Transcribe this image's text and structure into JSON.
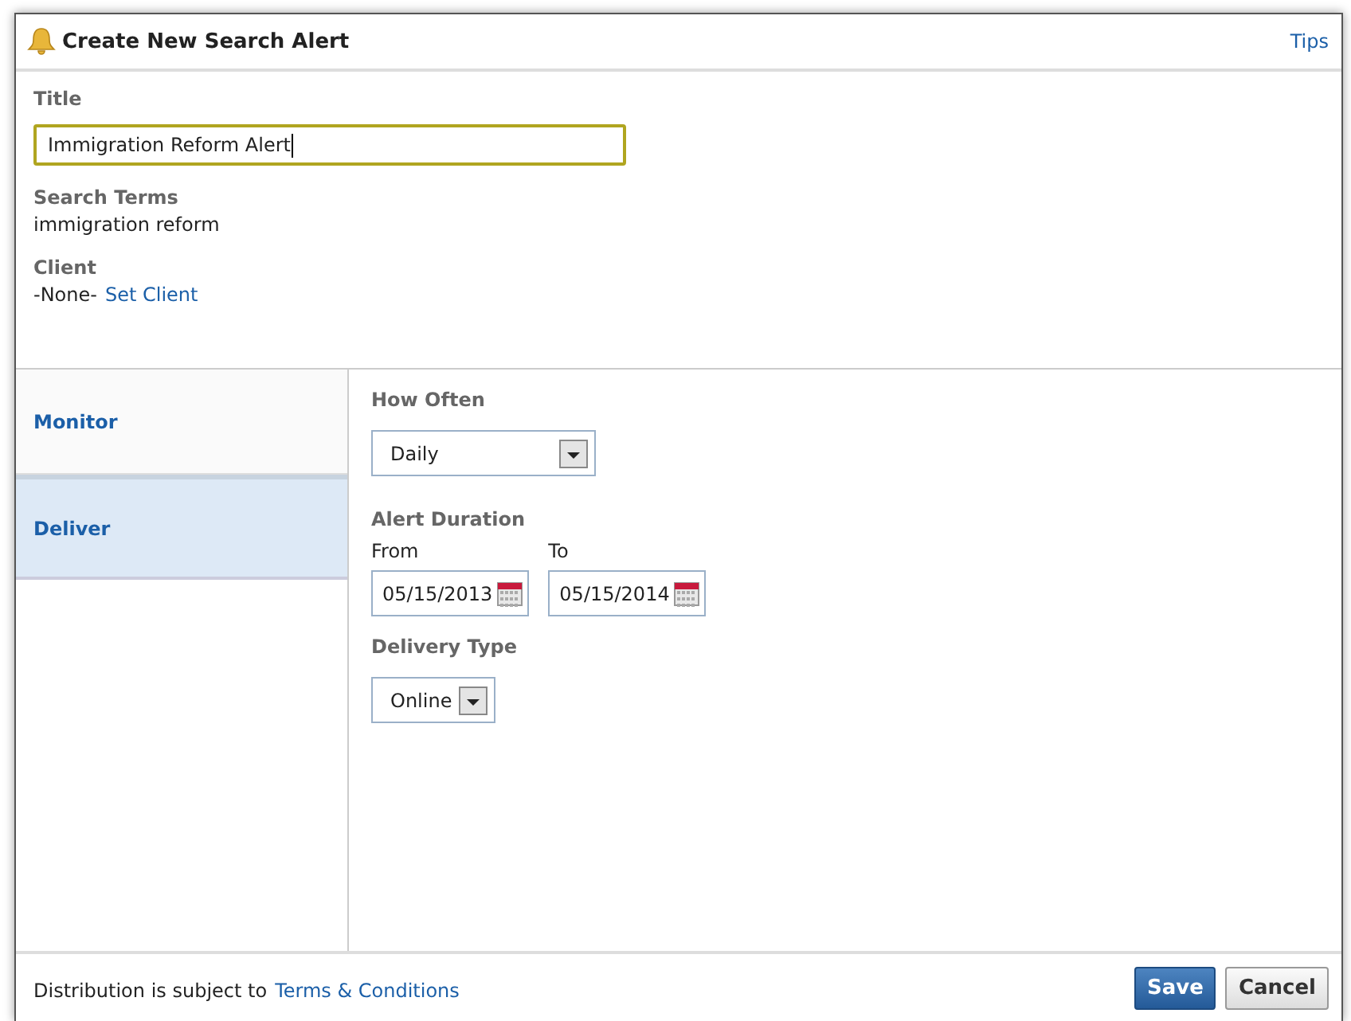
{
  "window": {
    "title": "Create New Search Alert",
    "tips_link": "Tips"
  },
  "title_field": {
    "label": "Title",
    "value": "Immigration Reform Alert"
  },
  "search_terms": {
    "label": "Search Terms",
    "value": "immigration reform"
  },
  "client": {
    "label": "Client",
    "value": "-None-",
    "link": "Set Client"
  },
  "nav": [
    {
      "label": "Monitor",
      "selected": false
    },
    {
      "label": "Deliver",
      "selected": true
    }
  ],
  "how_often": {
    "label": "How Often",
    "value": "Daily"
  },
  "alert_duration": {
    "label": "Alert Duration",
    "from_label": "From",
    "from_value": "05/15/2013",
    "to_label": "To",
    "to_value": "05/15/2014"
  },
  "delivery_type": {
    "label": "Delivery Type",
    "value": "Online"
  },
  "footer": {
    "text": "Distribution is subject to",
    "link": "Terms & Conditions",
    "buttons": [
      {
        "label": "Save",
        "kind": "primary"
      },
      {
        "label": "Cancel",
        "kind": "secondary"
      }
    ]
  }
}
